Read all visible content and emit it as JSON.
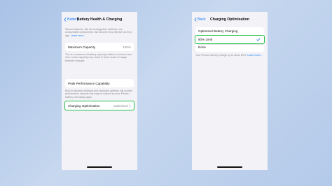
{
  "left": {
    "back_label": "Battery",
    "title": "Battery Health & Charging",
    "intro_caption": "iPhone batteries, like all rechargeable batteries, are consumable components that become less effective as they age.",
    "learn_more": "Learn more...",
    "max_capacity": {
      "label": "Maximum Capacity",
      "value": "100%"
    },
    "capacity_caption": "This is a measure of battery capacity relative to when it was new. Lower capacity may result in fewer hours of usage between charges.",
    "peak_performance": {
      "label": "Peak Performance Capability"
    },
    "peak_caption": "Built-in dynamic software and hardware systems will counter performance impacts that may be noticed as your iPhone battery chemically ages.",
    "charging_opt": {
      "label": "Charging Optimisation",
      "value": "Optimised"
    }
  },
  "right": {
    "back_label": "Back",
    "title": "Charging Optimisation",
    "options": [
      "Optimised Battery Charging",
      "80% Limit",
      "None"
    ],
    "selected_index": 1,
    "caption": "Your iPhone will only charge up to about 80%.",
    "learn_more": "Learn more..."
  },
  "colors": {
    "accent": "#1c7cf5",
    "highlight": "#27c24c",
    "background": "#f2f2f7"
  }
}
